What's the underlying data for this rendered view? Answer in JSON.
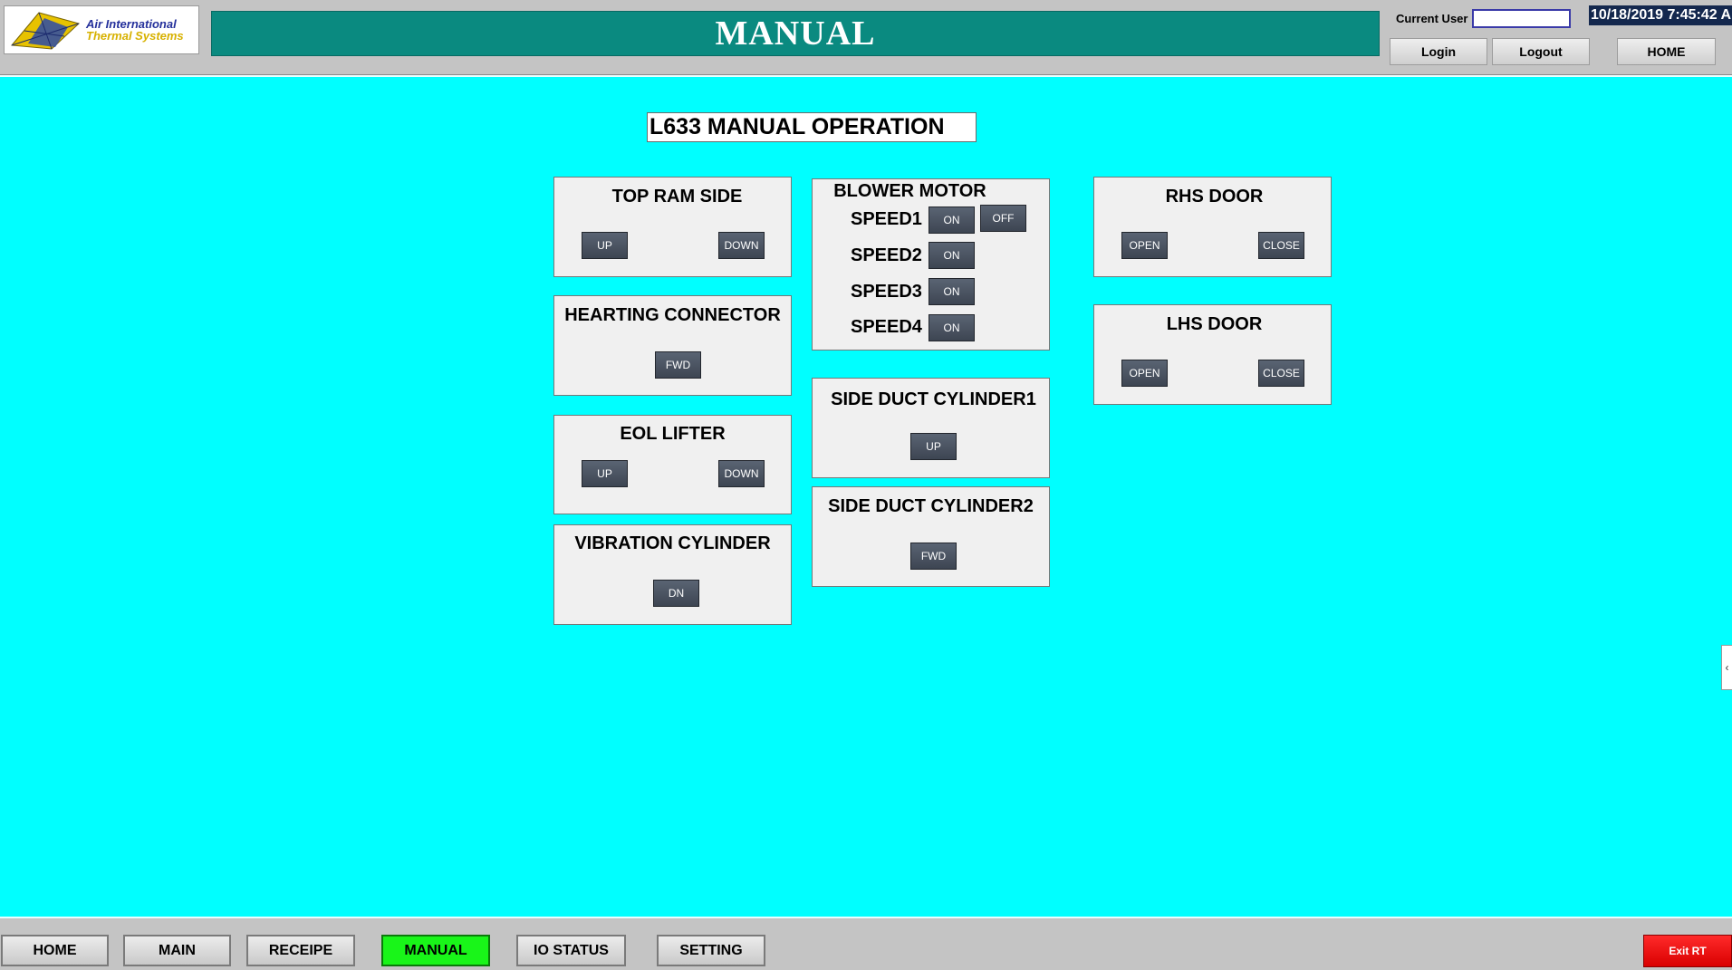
{
  "header": {
    "logo": {
      "line1": "Air International",
      "line2": "Thermal Systems"
    },
    "title": "MANUAL",
    "current_user_label": "Current User",
    "current_user_value": "",
    "datetime": "10/18/2019 7:45:42 A",
    "buttons": {
      "login": "Login",
      "logout": "Logout",
      "home": "HOME"
    }
  },
  "main": {
    "heading": "L633 MANUAL OPERATION",
    "panels": {
      "top_ram_side": {
        "title": "TOP RAM SIDE",
        "btn_up": "UP",
        "btn_down": "DOWN"
      },
      "hearting_connector": {
        "title": "HEARTING CONNECTOR",
        "btn_fwd": "FWD"
      },
      "eol_lifter": {
        "title": "EOL LIFTER",
        "btn_up": "UP",
        "btn_down": "DOWN"
      },
      "vibration_cylinder": {
        "title": "VIBRATION CYLINDER",
        "btn_dn": "DN"
      },
      "blower_motor": {
        "title": "BLOWER MOTOR",
        "speeds": [
          {
            "label": "SPEED1",
            "on": "ON",
            "off": "OFF"
          },
          {
            "label": "SPEED2",
            "on": "ON"
          },
          {
            "label": "SPEED3",
            "on": "ON"
          },
          {
            "label": "SPEED4",
            "on": "ON"
          }
        ]
      },
      "side_duct_cylinder1": {
        "title": "SIDE DUCT CYLINDER1",
        "btn_up": "UP"
      },
      "side_duct_cylinder2": {
        "title": "SIDE DUCT CYLINDER2",
        "btn_fwd": "FWD"
      },
      "rhs_door": {
        "title": "RHS DOOR",
        "btn_open": "OPEN",
        "btn_close": "CLOSE"
      },
      "lhs_door": {
        "title": "LHS DOOR",
        "btn_open": "OPEN",
        "btn_close": "CLOSE"
      }
    }
  },
  "footer": {
    "nav": [
      {
        "label": "HOME",
        "active": false
      },
      {
        "label": "MAIN",
        "active": false
      },
      {
        "label": "RECEIPE",
        "active": false
      },
      {
        "label": "MANUAL",
        "active": true
      },
      {
        "label": "IO STATUS",
        "active": false
      },
      {
        "label": "SETTING",
        "active": false
      }
    ],
    "exit_label": "Exit RT"
  },
  "colors": {
    "background": "#00ffff",
    "title_banner": "#0a8a80",
    "active_nav": "#19f519",
    "exit_button": "#ff0000",
    "panel_button": "#4a5260"
  }
}
